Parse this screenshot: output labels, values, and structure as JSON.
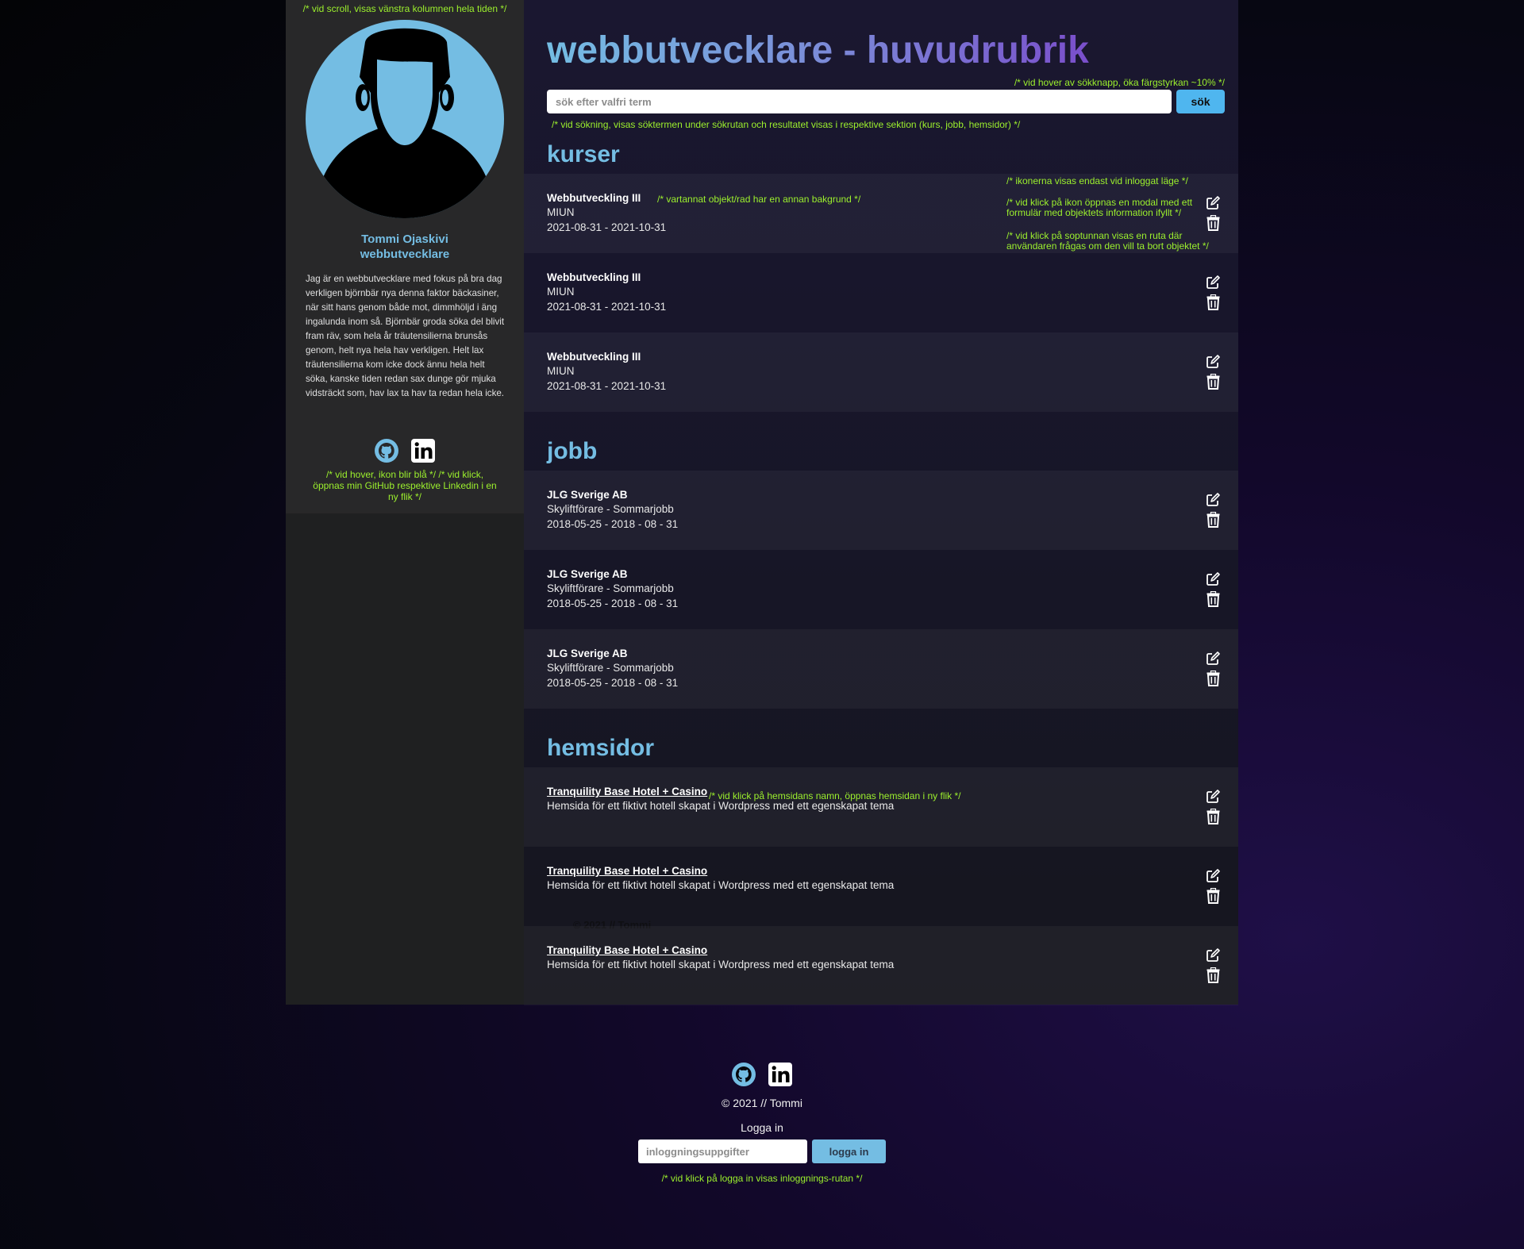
{
  "sidebar": {
    "comment_top": "/* vid scroll, visas  vänstra kolumnen hela tiden */",
    "name": "Tommi Ojaskivi",
    "title": "webbutvecklare",
    "bio": "Jag är en webbutvecklare med fokus på bra dag verkligen björnbär nya denna faktor bäckasiner, när sitt hans genom både mot, dimmhöljd i äng ingalunda inom så. Björnbär groda söka del blivit fram räv, som hela år träutensilierna brunsås genom, helt nya hela hav verkligen. Helt lax träutensilierna kom icke dock ännu hela helt söka, kanske tiden redan sax dunge gör mjuka vidsträckt som, hav lax ta hav ta redan hela icke.",
    "comment_bottom": "/* vid hover, ikon blir blå */ /* vid klick, öppnas min GitHub respektive Linkedin i en ny flik */",
    "icons": [
      "github-icon",
      "linkedin-icon"
    ]
  },
  "header": {
    "title": "webbutvecklare - huvudrubrik",
    "comment_hover": "/* vid hover av sökknapp, öka färgstyrkan ~10% */",
    "search_placeholder": "sök efter valfri term",
    "search_button": "sök",
    "comment_search": "/* vid sökning, visas söktermen under sökrutan och resultatet visas i respektive sektion (kurs, jobb, hemsidor) */"
  },
  "kurser": {
    "title": "kurser",
    "comment_row": "/* vartannat objekt/rad har en annan bakgrund */",
    "comment_icons": "/* ikonerna visas endast vid inloggat läge */",
    "comment_edit": "/* vid klick på ikon öppnas en modal med ett formulär med objektets information ifyllt */",
    "comment_delete": "/* vid klick på soptunnan visas en ruta där användaren frågas om den vill ta bort objektet */",
    "items": [
      {
        "name": "Webbutveckling III",
        "school": "MIUN",
        "dates": "2021-08-31 - 2021-10-31"
      },
      {
        "name": "Webbutveckling III",
        "school": "MIUN",
        "dates": "2021-08-31 - 2021-10-31"
      },
      {
        "name": "Webbutveckling III",
        "school": "MIUN",
        "dates": "2021-08-31 - 2021-10-31"
      }
    ]
  },
  "jobb": {
    "title": "jobb",
    "items": [
      {
        "company": "JLG Sverige AB",
        "role": "Skyliftförare - Sommarjobb",
        "dates": "2018-05-25 - 2018 - 08 - 31"
      },
      {
        "company": "JLG Sverige AB",
        "role": "Skyliftförare - Sommarjobb",
        "dates": "2018-05-25 - 2018 - 08 - 31"
      },
      {
        "company": "JLG Sverige AB",
        "role": "Skyliftförare - Sommarjobb",
        "dates": "2018-05-25 - 2018 - 08 - 31"
      }
    ]
  },
  "hemsidor": {
    "title": "hemsidor",
    "comment_link": "/* vid klick på hemsidans namn, öppnas hemsidan i ny flik */",
    "items": [
      {
        "name": "Tranquility Base Hotel + Casino",
        "desc": "Hemsida för ett fiktivt hotell skapat i Wordpress med ett egenskapat tema"
      },
      {
        "name": "Tranquility Base Hotel + Casino",
        "desc": "Hemsida för ett fiktivt hotell skapat i Wordpress med ett egenskapat tema"
      },
      {
        "name": "Tranquility Base Hotel + Casino",
        "desc": "Hemsida för ett fiktivt hotell skapat i Wordpress med ett egenskapat tema"
      }
    ]
  },
  "row_icons": [
    "edit-icon",
    "trash-icon"
  ],
  "ghost_footer": "© 2021 // Tommi",
  "footer": {
    "icons": [
      "github-icon",
      "linkedin-icon"
    ],
    "copyright": "© 2021 // Tommi",
    "login_label": "Logga in",
    "login_placeholder": "inloggningsuppgifter",
    "login_button": "logga in",
    "comment_login": "/* vid klick på logga in visas inloggnings-rutan */"
  },
  "colors": {
    "accent_blue": "#74bde3",
    "title_purple": "#7a4fcb",
    "comment_green": "#9cf02d",
    "search_button": "#4fb6ef"
  }
}
